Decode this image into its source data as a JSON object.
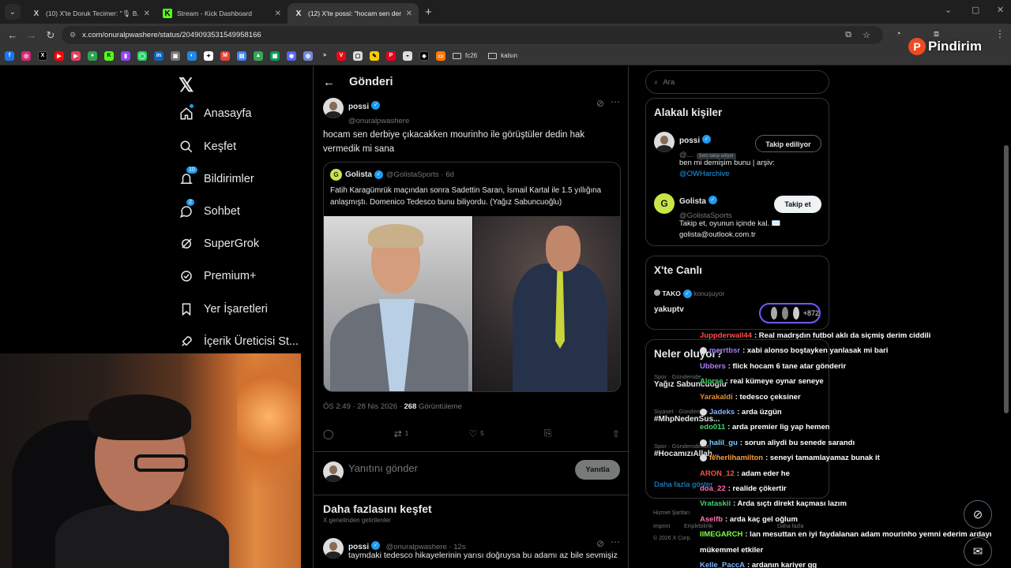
{
  "browser": {
    "tabs": [
      {
        "icon": "X",
        "title": "(10) X'te Doruk Tecimer: \"🎙 B..."
      },
      {
        "icon": "K",
        "title": "Stream - Kick Dashboard"
      },
      {
        "icon": "X",
        "title": "(12) X'te possi: \"hocam sen der...",
        "active": true
      }
    ],
    "url": "x.com/onuralpwashere/status/2049093531549958166",
    "bookmark_folders": [
      "fc26",
      "kalsın"
    ]
  },
  "overlay": {
    "brand": "Pindirim"
  },
  "nav": {
    "items": [
      {
        "label": "Anasayfa",
        "icon": "home-icon"
      },
      {
        "label": "Keşfet",
        "icon": "search-icon"
      },
      {
        "label": "Bildirimler",
        "icon": "bell-icon",
        "badge": "10"
      },
      {
        "label": "Sohbet",
        "icon": "chat-icon",
        "badge": "2"
      },
      {
        "label": "SuperGrok",
        "icon": "grok-icon"
      },
      {
        "label": "Premium+",
        "icon": "premium-icon"
      },
      {
        "label": "Yer İşaretleri",
        "icon": "bookmark-icon"
      },
      {
        "label": "İçerik Üreticisi St...",
        "icon": "rocket-icon"
      }
    ]
  },
  "post": {
    "header_title": "Gönderi",
    "author_name": "possi",
    "author_handle": "@onuralpwashere",
    "text": "hocam sen derbiye çıkacakken mourinho ile görüştüler dedin hak vermedik mi sana",
    "quote": {
      "name": "Golista",
      "handle": "@GolistaSports",
      "time": "· 6d",
      "text": "Fatih Karagümrük maçından sonra Sadettin Saran, İsmail Kartal ile 1.5 yıllığına anlaşmıştı. Domenico Tedesco bunu biliyordu. (Yağız Sabuncuoğlu)"
    },
    "time": "ÖS 2:49 · 28 Nis 2026 · ",
    "views": "268",
    "views_label": " Görüntüleme",
    "retweets": "1",
    "likes": "5",
    "reply_placeholder": "Yanıtını gönder",
    "reply_button": "Yanıtla"
  },
  "discover": {
    "title": "Daha fazlasını keşfet",
    "subtitle": "X genelinden getirilenler",
    "tweet": {
      "name": "possi",
      "handle": "@onuralpwashere · 12s",
      "text": "taymdaki tedesco hikayelerinin yarısı doğruysa bu adamı az bile sevmişiz"
    }
  },
  "sidebar": {
    "search_placeholder": "Ara",
    "related_title": "Alakalı kişiler",
    "person1": {
      "name": "possi",
      "handle": "@...",
      "follows_badge": "Seni takip ediyor",
      "button": "Takip ediliyor",
      "bio": "ben mi demişim bunu | arşiv:",
      "bio_link": "@OWHarchive"
    },
    "person2": {
      "name": "Golista",
      "handle": "@GolistaSports",
      "button": "Takip et",
      "bio1": "Takip et, oyunun içinde kal. ✉️",
      "bio2": "golista@outlook.com.tr"
    },
    "live_title": "X'te Canlı",
    "live_host": "TAKO",
    "live_status": "konuşuyor",
    "live_name": "yakuptv",
    "live_count": "+872",
    "trends_title": "Neler oluyor?",
    "trends": [
      {
        "cat": "Spor · Gündemde",
        "name": "Yağız Sabuncuoğlu"
      },
      {
        "cat": "Siyaset · Gündemde",
        "name": "#MhpNedenSus..."
      },
      {
        "cat": "Spor · Gündemdekiler",
        "name": "#HocamızıAllah..."
      }
    ],
    "show_more": "Daha fazla göster",
    "footer": [
      "Hizmet Şartları",
      "Imprint",
      "Erişilebilirlik",
      "Daha fazla",
      "© 2026 X Corp."
    ]
  },
  "chat": [
    {
      "user": "Juppderwall44",
      "color": "#ff4d4d",
      "msg": ": Real madrşdın futbol aklı da siçmiş derim ciddili"
    },
    {
      "user": "merrtbsr",
      "color": "#a37bff",
      "msg": ": xabi alonso boştayken yanlasak mi bari",
      "icon": true
    },
    {
      "user": "Ubbers",
      "color": "#b07cff",
      "msg": ": flick hocam 6 tane atar gönderir"
    },
    {
      "user": "Alorse",
      "color": "#3fd46b",
      "msg": ": real kümeye oynar seneye"
    },
    {
      "user": "Yarakaldi",
      "color": "#e0902f",
      "msg": ": tedesco çeksiner"
    },
    {
      "user": "Jadeks",
      "color": "#7fb3ff",
      "msg": ": arda üzgün",
      "icon": true
    },
    {
      "user": "edo011",
      "color": "#3fd46b",
      "msg": ": arda premier lig yap hemen"
    },
    {
      "user": "halil_gu",
      "color": "#6fd1ff",
      "msg": ": sorun aliydi bu senede sarandı",
      "icon": true
    },
    {
      "user": "fenerlihamilton",
      "color": "#ff9d3f",
      "msg": ": seneyi tamamlayamaz bunak it",
      "icon": true
    },
    {
      "user": "ARON_12",
      "color": "#ff4d4d",
      "msg": ": adam eder he"
    },
    {
      "user": "doa_22",
      "color": "#ff6fb5",
      "msg": ": realide çökertir"
    },
    {
      "user": "Vrataskii",
      "color": "#3fd46b",
      "msg": ": Arda sıçtı direkt kaçması lazım"
    },
    {
      "user": "Aselfb",
      "color": "#ff6fb5",
      "msg": ": arda kaç gel oğlum"
    },
    {
      "user": "IIMEGARCH",
      "color": "#7dff4d",
      "msg": ": lan mesuttan en iyi faydalanan adam mourinho yemni ederim ardayı"
    },
    {
      "user": "",
      "color": "#ffffff",
      "msg": "mükemmel etkiler"
    },
    {
      "user": "Kelle_PaccA",
      "color": "#7fb3ff",
      "msg": ": ardanın kariyer gg"
    }
  ],
  "colors": {
    "accent": "#1d9bf0",
    "bg": "#000000",
    "border": "#2f3336"
  }
}
